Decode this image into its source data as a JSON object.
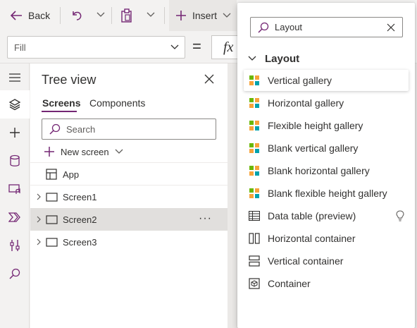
{
  "toolbar": {
    "back_label": "Back",
    "insert_label": "Insert"
  },
  "formula": {
    "property_value": "Fill",
    "equals": "=",
    "fx_label": "fx"
  },
  "tree_view": {
    "title": "Tree view",
    "tabs": [
      "Screens",
      "Components"
    ],
    "active_tab": "Screens",
    "search_placeholder": "Search",
    "new_screen_label": "New screen",
    "items": [
      {
        "label": "App"
      },
      {
        "label": "Screen1"
      },
      {
        "label": "Screen2"
      },
      {
        "label": "Screen3"
      }
    ],
    "selected_item": "Screen2",
    "more_label": "···"
  },
  "insert_menu": {
    "search_value": "Layout",
    "category": "Layout",
    "items": [
      {
        "label": "Vertical gallery",
        "icon": "gallery-icon"
      },
      {
        "label": "Horizontal gallery",
        "icon": "gallery-icon"
      },
      {
        "label": "Flexible height gallery",
        "icon": "gallery-icon"
      },
      {
        "label": "Blank vertical gallery",
        "icon": "gallery-icon"
      },
      {
        "label": "Blank horizontal gallery",
        "icon": "gallery-icon"
      },
      {
        "label": "Blank flexible height gallery",
        "icon": "gallery-icon"
      },
      {
        "label": "Data table (preview)",
        "icon": "table-icon"
      },
      {
        "label": "Horizontal container",
        "icon": "horizontal-container-icon"
      },
      {
        "label": "Vertical container",
        "icon": "vertical-container-icon"
      },
      {
        "label": "Container",
        "icon": "container-icon"
      }
    ],
    "hovered_item": "Vertical gallery"
  },
  "colors": {
    "accent": "#742774",
    "gallery_green": "#6bb700",
    "gallery_orange": "#f7a33a",
    "gallery_blue": "#00a2ad"
  }
}
